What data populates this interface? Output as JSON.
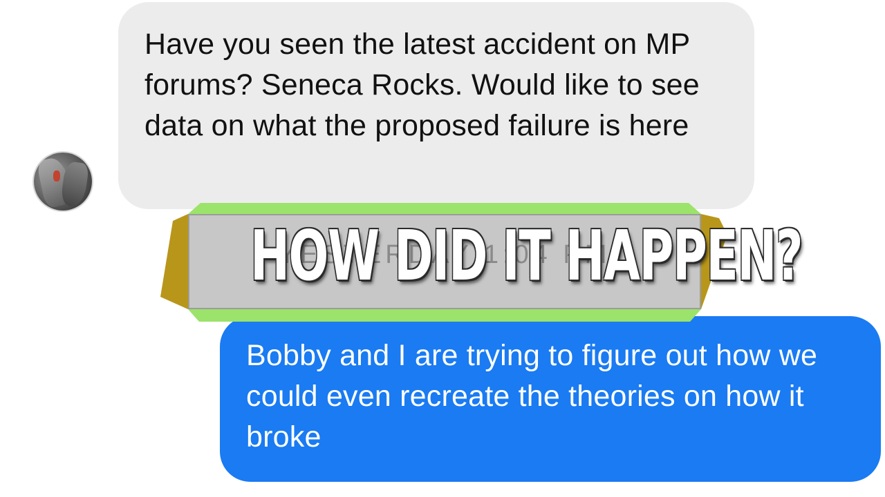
{
  "conversation": {
    "incoming_message": "Have you seen the latest accident on MP forums? Seneca Rocks. Would like to see data on what the proposed failure is here",
    "timestamp": "YESTERDAY 1:04 PM",
    "outgoing_message": "Bobby and I are trying to figure out how we could even recreate the theories on how it broke"
  },
  "overlay": {
    "headline": "HOW DID IT HAPPEN?"
  },
  "colors": {
    "incoming_bubble": "#ececec",
    "outgoing_bubble": "#1a7bf2",
    "banner_gold": "#b8961a",
    "banner_green": "#9be36a",
    "banner_panel": "#c7c7c7"
  },
  "icons": {
    "avatar": "climber-avatar-icon"
  }
}
